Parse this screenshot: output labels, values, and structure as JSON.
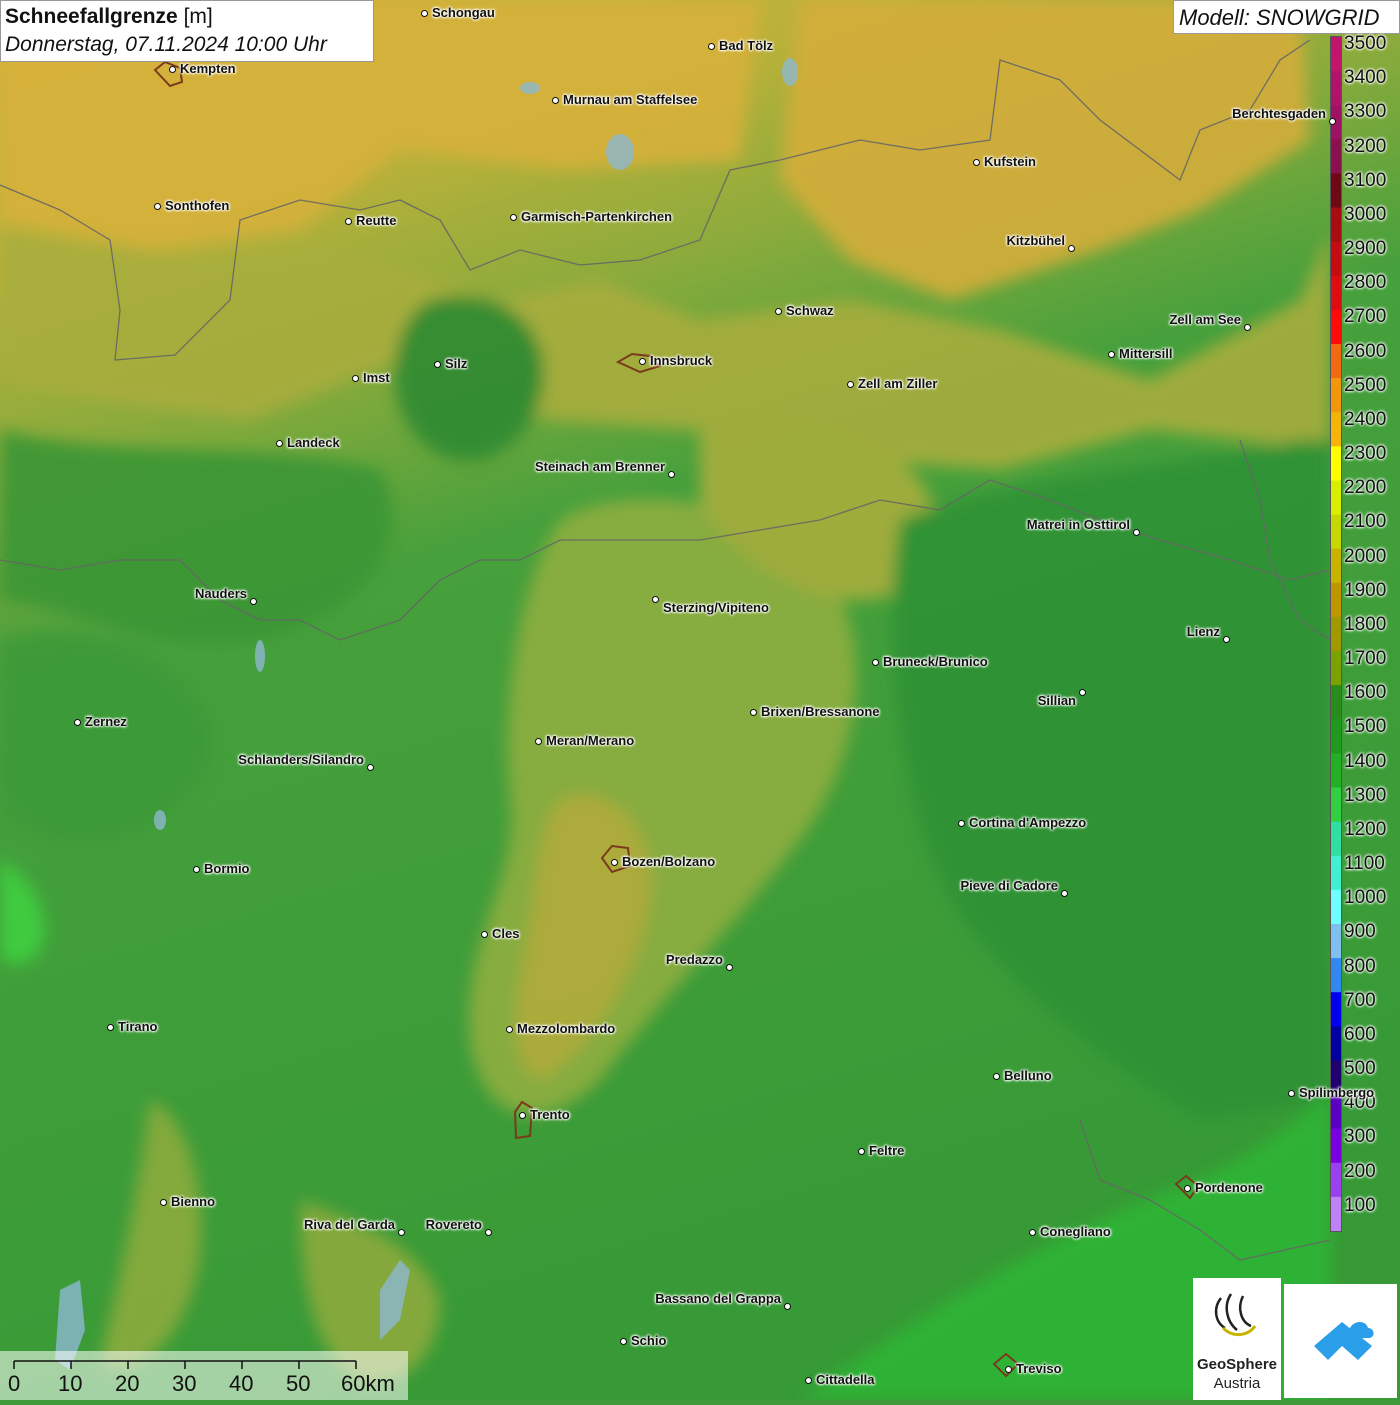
{
  "header": {
    "title": "Schneefallgrenze",
    "unit": "[m]",
    "date": "Donnerstag, 07.11.2024 10:00 Uhr",
    "model": "Modell: SNOWGRID"
  },
  "legend": {
    "labels": [
      "3500",
      "3400",
      "3300",
      "3200",
      "3100",
      "3000",
      "2900",
      "2800",
      "2700",
      "2600",
      "2500",
      "2400",
      "2300",
      "2200",
      "2100",
      "2000",
      "1900",
      "1800",
      "1700",
      "1600",
      "1500",
      "1400",
      "1300",
      "1200",
      "1100",
      "1000",
      "900",
      "800",
      "700",
      "600",
      "500",
      "400",
      "300",
      "200",
      "100"
    ],
    "colors": [
      "#c2156e",
      "#b0146a",
      "#9e1265",
      "#8a1050",
      "#6e0a15",
      "#a80d12",
      "#c40d12",
      "#de0d12",
      "#ff0a0a",
      "#f06a12",
      "#f2960a",
      "#f5b40a",
      "#ffff00",
      "#d8f000",
      "#c5d800",
      "#c8b400",
      "#c09600",
      "#a09a00",
      "#7ca200",
      "#278c1a",
      "#1f9a1f",
      "#24b024",
      "#30d040",
      "#30e0a0",
      "#40f0d0",
      "#70ffff",
      "#80c0f0",
      "#3088f0",
      "#0000f0",
      "#0000a0",
      "#200070",
      "#5a00c0",
      "#7800e0",
      "#9a40f0",
      "#c080f8"
    ]
  },
  "cities": [
    {
      "name": "Schongau"
    },
    {
      "name": "Bad Tölz"
    },
    {
      "name": "Kempten"
    },
    {
      "name": "Murnau am Staffelsee"
    },
    {
      "name": "Berchtesgaden"
    },
    {
      "name": "Kufstein"
    },
    {
      "name": "Sonthofen"
    },
    {
      "name": "Reutte"
    },
    {
      "name": "Garmisch-Partenkirchen"
    },
    {
      "name": "Kitzbühel"
    },
    {
      "name": "Schwaz"
    },
    {
      "name": "Zell am See"
    },
    {
      "name": "Innsbruck"
    },
    {
      "name": "Silz"
    },
    {
      "name": "Imst"
    },
    {
      "name": "Mittersill"
    },
    {
      "name": "Zell am Ziller"
    },
    {
      "name": "Landeck"
    },
    {
      "name": "Steinach am Brenner"
    },
    {
      "name": "Matrei in Osttirol"
    },
    {
      "name": "Nauders"
    },
    {
      "name": "Sterzing/Vipiteno"
    },
    {
      "name": "Lienz"
    },
    {
      "name": "Bruneck/Brunico"
    },
    {
      "name": "Sillian"
    },
    {
      "name": "Brixen/Bressanone"
    },
    {
      "name": "Zernez"
    },
    {
      "name": "Meran/Merano"
    },
    {
      "name": "Schlanders/Silandro"
    },
    {
      "name": "Cortina d'Ampezzo"
    },
    {
      "name": "Bozen/Bolzano"
    },
    {
      "name": "Bormio"
    },
    {
      "name": "Pieve di Cadore"
    },
    {
      "name": "Cles"
    },
    {
      "name": "Predazzo"
    },
    {
      "name": "Tirano"
    },
    {
      "name": "Mezzolombardo"
    },
    {
      "name": "Belluno"
    },
    {
      "name": "Spilimbergo"
    },
    {
      "name": "Trento"
    },
    {
      "name": "Feltre"
    },
    {
      "name": "Pordenone"
    },
    {
      "name": "Bienno"
    },
    {
      "name": "Riva del Garda"
    },
    {
      "name": "Rovereto"
    },
    {
      "name": "Conegliano"
    },
    {
      "name": "Bassano del Grappa"
    },
    {
      "name": "Schio"
    },
    {
      "name": "Treviso"
    },
    {
      "name": "Cittadella"
    }
  ],
  "scale": {
    "labels": [
      "0",
      "10",
      "20",
      "30",
      "40",
      "50",
      "60km"
    ]
  },
  "logos": {
    "geosphere_line1": "GeoSphere",
    "geosphere_line2": "Austria"
  }
}
